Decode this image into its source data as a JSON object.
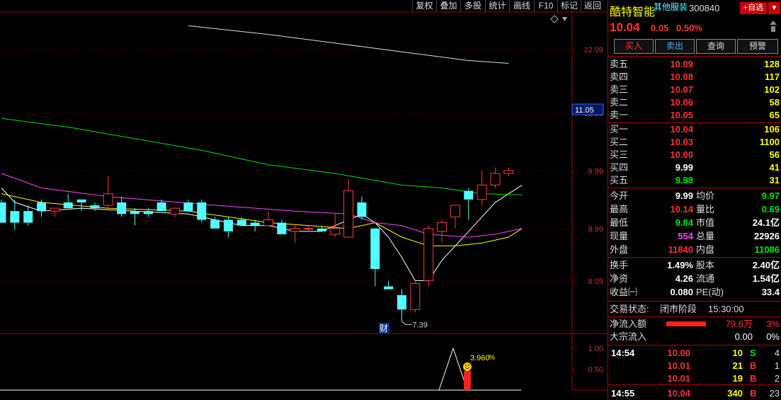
{
  "toolbar": [
    "复权",
    "叠加",
    "多股",
    "统计",
    "画线",
    "F10",
    "标记",
    "返回"
  ],
  "chart": {
    "price_axis": [
      "12.09",
      "10.99",
      "9.99",
      "8.99",
      "8.09"
    ],
    "price_tag": "11.05",
    "low_label": "7.39",
    "news_badge": "财",
    "indicator_axis": [
      "1.00",
      "0.50"
    ],
    "indicator_value": "3.960",
    "indicator_unit": "%"
  },
  "chart_data": {
    "type": "candlestick",
    "candles": [
      {
        "o": 9.45,
        "h": 9.5,
        "l": 9.1,
        "c": 9.1
      },
      {
        "o": 9.3,
        "h": 9.5,
        "l": 8.98,
        "c": 9.1
      },
      {
        "o": 9.3,
        "h": 9.4,
        "l": 9.05,
        "c": 9.1
      },
      {
        "o": 9.45,
        "h": 9.5,
        "l": 9.2,
        "c": 9.3
      },
      {
        "o": 9.3,
        "h": 9.35,
        "l": 9.2,
        "c": 9.35
      },
      {
        "o": 9.45,
        "h": 9.6,
        "l": 9.35,
        "c": 9.35
      },
      {
        "o": 9.5,
        "h": 9.5,
        "l": 9.3,
        "c": 9.45
      },
      {
        "o": 9.4,
        "h": 9.45,
        "l": 9.3,
        "c": 9.35
      },
      {
        "o": 9.4,
        "h": 9.9,
        "l": 9.3,
        "c": 9.6
      },
      {
        "o": 9.45,
        "h": 9.55,
        "l": 9.2,
        "c": 9.25
      },
      {
        "o": 9.3,
        "h": 9.35,
        "l": 9.05,
        "c": 9.25
      },
      {
        "o": 9.3,
        "h": 9.35,
        "l": 9.2,
        "c": 9.25
      },
      {
        "o": 9.45,
        "h": 9.5,
        "l": 9.3,
        "c": 9.3
      },
      {
        "o": 9.25,
        "h": 9.35,
        "l": 9.2,
        "c": 9.35
      },
      {
        "o": 9.45,
        "h": 9.5,
        "l": 9.3,
        "c": 9.3
      },
      {
        "o": 9.45,
        "h": 9.5,
        "l": 9.1,
        "c": 9.15
      },
      {
        "o": 9.15,
        "h": 9.2,
        "l": 9.0,
        "c": 9.0
      },
      {
        "o": 9.15,
        "h": 9.2,
        "l": 8.85,
        "c": 8.95
      },
      {
        "o": 9.15,
        "h": 9.2,
        "l": 9.05,
        "c": 9.05
      },
      {
        "o": 9.1,
        "h": 9.15,
        "l": 8.95,
        "c": 9.05
      },
      {
        "o": 9.05,
        "h": 9.3,
        "l": 9.05,
        "c": 9.15
      },
      {
        "o": 9.1,
        "h": 9.15,
        "l": 8.9,
        "c": 8.9
      },
      {
        "o": 8.95,
        "h": 9.05,
        "l": 8.75,
        "c": 9.0
      },
      {
        "o": 9.0,
        "h": 9.05,
        "l": 8.95,
        "c": 9.0
      },
      {
        "o": 9.0,
        "h": 9.05,
        "l": 8.95,
        "c": 8.95
      },
      {
        "o": 8.9,
        "h": 9.25,
        "l": 8.85,
        "c": 9.0
      },
      {
        "o": 8.85,
        "h": 9.85,
        "l": 8.85,
        "c": 9.65
      },
      {
        "o": 9.45,
        "h": 9.55,
        "l": 9.15,
        "c": 9.2
      },
      {
        "o": 9.0,
        "h": 9.0,
        "l": 8.0,
        "c": 8.3
      },
      {
        "o": 8.0,
        "h": 8.1,
        "l": 7.95,
        "c": 7.95
      },
      {
        "o": 7.85,
        "h": 7.95,
        "l": 7.39,
        "c": 7.6
      },
      {
        "o": 7.6,
        "h": 8.1,
        "l": 7.55,
        "c": 8.05
      },
      {
        "o": 8.1,
        "h": 9.05,
        "l": 8.0,
        "c": 9.0
      },
      {
        "o": 8.95,
        "h": 9.15,
        "l": 8.75,
        "c": 9.1
      },
      {
        "o": 9.2,
        "h": 9.4,
        "l": 9.0,
        "c": 9.4
      },
      {
        "o": 9.65,
        "h": 9.7,
        "l": 9.15,
        "c": 9.5
      },
      {
        "o": 9.5,
        "h": 10.0,
        "l": 9.4,
        "c": 9.75
      },
      {
        "o": 9.75,
        "h": 10.05,
        "l": 9.7,
        "c": 9.95
      },
      {
        "o": 9.95,
        "h": 10.05,
        "l": 9.9,
        "c": 10.0
      }
    ],
    "moving_averages": [
      {
        "color": "#ffffff",
        "points": [
          [
            0,
            9.7
          ],
          [
            1,
            9.45
          ],
          [
            3,
            9.3
          ],
          [
            6,
            9.35
          ],
          [
            10,
            9.3
          ],
          [
            14,
            9.25
          ],
          [
            18,
            9.05
          ],
          [
            20,
            9.05
          ],
          [
            22,
            8.95
          ],
          [
            24,
            8.95
          ],
          [
            26,
            9.15
          ],
          [
            27,
            9.25
          ],
          [
            28,
            9.1
          ],
          [
            29,
            8.85
          ],
          [
            30,
            8.5
          ],
          [
            31,
            8.1
          ],
          [
            32,
            8.1
          ],
          [
            33,
            8.45
          ],
          [
            35,
            8.95
          ],
          [
            37,
            9.45
          ],
          [
            39,
            9.75
          ]
        ]
      },
      {
        "color": "#ffff00",
        "points": [
          [
            0,
            9.6
          ],
          [
            3,
            9.45
          ],
          [
            8,
            9.35
          ],
          [
            14,
            9.3
          ],
          [
            20,
            9.1
          ],
          [
            26,
            9.0
          ],
          [
            28,
            9.1
          ],
          [
            30,
            8.85
          ],
          [
            32,
            8.7
          ],
          [
            34,
            8.7
          ],
          [
            36,
            8.75
          ],
          [
            38,
            8.85
          ],
          [
            39,
            9.0
          ]
        ]
      },
      {
        "color": "#ff44ff",
        "points": [
          [
            0,
            9.95
          ],
          [
            3,
            9.7
          ],
          [
            8,
            9.55
          ],
          [
            16,
            9.4
          ],
          [
            22,
            9.3
          ],
          [
            26,
            9.25
          ],
          [
            28,
            9.1
          ],
          [
            30,
            9.05
          ],
          [
            32,
            8.9
          ],
          [
            35,
            8.85
          ],
          [
            37,
            8.9
          ],
          [
            39,
            9.0
          ]
        ]
      },
      {
        "color": "#00dd00",
        "points": [
          [
            0,
            10.9
          ],
          [
            5,
            10.75
          ],
          [
            10,
            10.55
          ],
          [
            15,
            10.35
          ],
          [
            20,
            10.1
          ],
          [
            25,
            9.95
          ],
          [
            30,
            9.75
          ],
          [
            33,
            9.7
          ],
          [
            36,
            9.6
          ],
          [
            39,
            9.58
          ]
        ]
      },
      {
        "color": "#dddddd",
        "points": [
          [
            14,
            12.5
          ],
          [
            20,
            12.35
          ],
          [
            25,
            12.2
          ],
          [
            30,
            12.05
          ],
          [
            35,
            11.9
          ],
          [
            38,
            11.85
          ]
        ]
      }
    ],
    "y_range": [
      7.2,
      12.7
    ]
  },
  "panel": {
    "stock_name": "酷特智能",
    "industry": "其他服装",
    "code": "300840",
    "add_watch": "+自选",
    "price": "10.04",
    "change": "0.05",
    "change_pct": "0.50%",
    "actions": [
      "买入",
      "卖出",
      "查询",
      "预警"
    ],
    "asks": [
      {
        "label": "卖五",
        "price": "10.09",
        "vol": "128"
      },
      {
        "label": "卖四",
        "price": "10.08",
        "vol": "117"
      },
      {
        "label": "卖三",
        "price": "10.07",
        "vol": "102"
      },
      {
        "label": "卖二",
        "price": "10.06",
        "vol": "58"
      },
      {
        "label": "卖一",
        "price": "10.05",
        "vol": "65"
      }
    ],
    "bids": [
      {
        "label": "买一",
        "price": "10.04",
        "vol": "106"
      },
      {
        "label": "买二",
        "price": "10.03",
        "vol": "1100"
      },
      {
        "label": "买三",
        "price": "10.00",
        "vol": "56"
      },
      {
        "label": "买四",
        "price": "9.99",
        "vol": "41"
      },
      {
        "label": "买五",
        "price": "9.98",
        "vol": "31"
      }
    ],
    "stats1": [
      {
        "l1": "今开",
        "v1": "9.99",
        "l2": "均价",
        "v2": "9.97"
      },
      {
        "l1": "最高",
        "v1": "10.14",
        "l2": "量比",
        "v2": "0.69"
      },
      {
        "l1": "最低",
        "v1": "9.84",
        "l2": "市值",
        "v2": "24.1亿"
      },
      {
        "l1": "现量",
        "v1": "554",
        "l2": "总量",
        "v2": "22926"
      },
      {
        "l1": "外盘",
        "v1": "11840",
        "l2": "内盘",
        "v2": "11086"
      }
    ],
    "stats2": [
      {
        "l1": "换手",
        "v1": "1.49%",
        "l2": "股本",
        "v2": "2.40亿"
      },
      {
        "l1": "净资",
        "v1": "4.26",
        "l2": "流通",
        "v2": "1.54亿"
      },
      {
        "l1": "收益㈠",
        "v1": "0.080",
        "l2": "PE(动)",
        "v2": "33.4"
      }
    ],
    "trade_status": {
      "label": "交易状态:",
      "value": "闭市阶段",
      "time": "15:30:00"
    },
    "net_inflow": {
      "label": "净流入额",
      "value": "79.6万",
      "pct": "3%",
      "bar_fraction": 0.8
    },
    "block_inflow": {
      "label": "大宗流入",
      "value": "0.00",
      "pct": "0%"
    },
    "ticks": [
      {
        "time": "14:54",
        "price": "10.00",
        "vol": "10",
        "side": "S",
        "n": "4"
      },
      {
        "time": "",
        "price": "10.01",
        "vol": "21",
        "side": "B",
        "n": "1"
      },
      {
        "time": "",
        "price": "10.01",
        "vol": "19",
        "side": "B",
        "n": "2"
      },
      {
        "time": "14:55",
        "price": "10.04",
        "vol": "340",
        "side": "B",
        "n": "23"
      }
    ]
  }
}
